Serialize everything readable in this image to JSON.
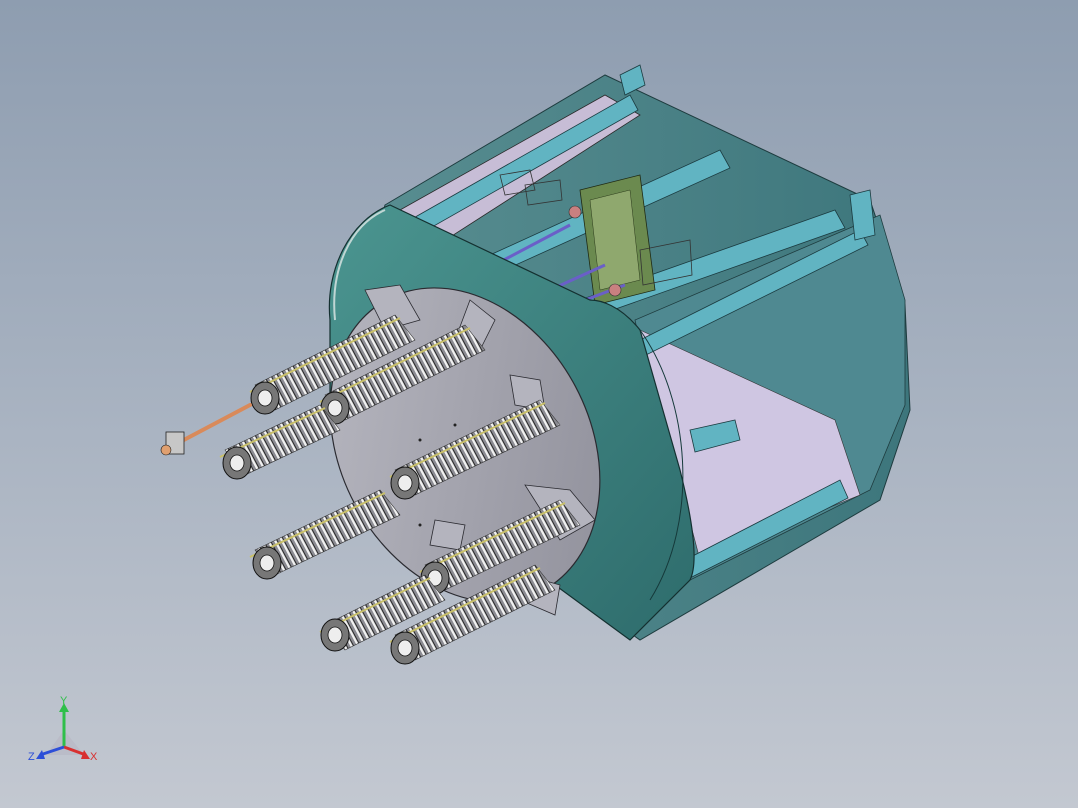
{
  "viewport": {
    "background_top": "#8e9db0",
    "background_bottom": "#c3c8d1"
  },
  "model": {
    "housing_color": "#3f8a86",
    "housing_dark": "#2f6f70",
    "rail_color": "#5fb0bd",
    "flange_color": "#a9a9b4",
    "coil_color": "#c9c06a",
    "pcb_color": "#6b8a4f",
    "rod_color": "#6a5fc8",
    "copper_color": "#d98a5a",
    "heater_count": 8
  },
  "triad": {
    "y_label": "Y",
    "x_label": "X",
    "z_label": "Z",
    "y_color": "#2fbf4a",
    "x_color": "#d83030",
    "z_color": "#2d4fd8"
  }
}
